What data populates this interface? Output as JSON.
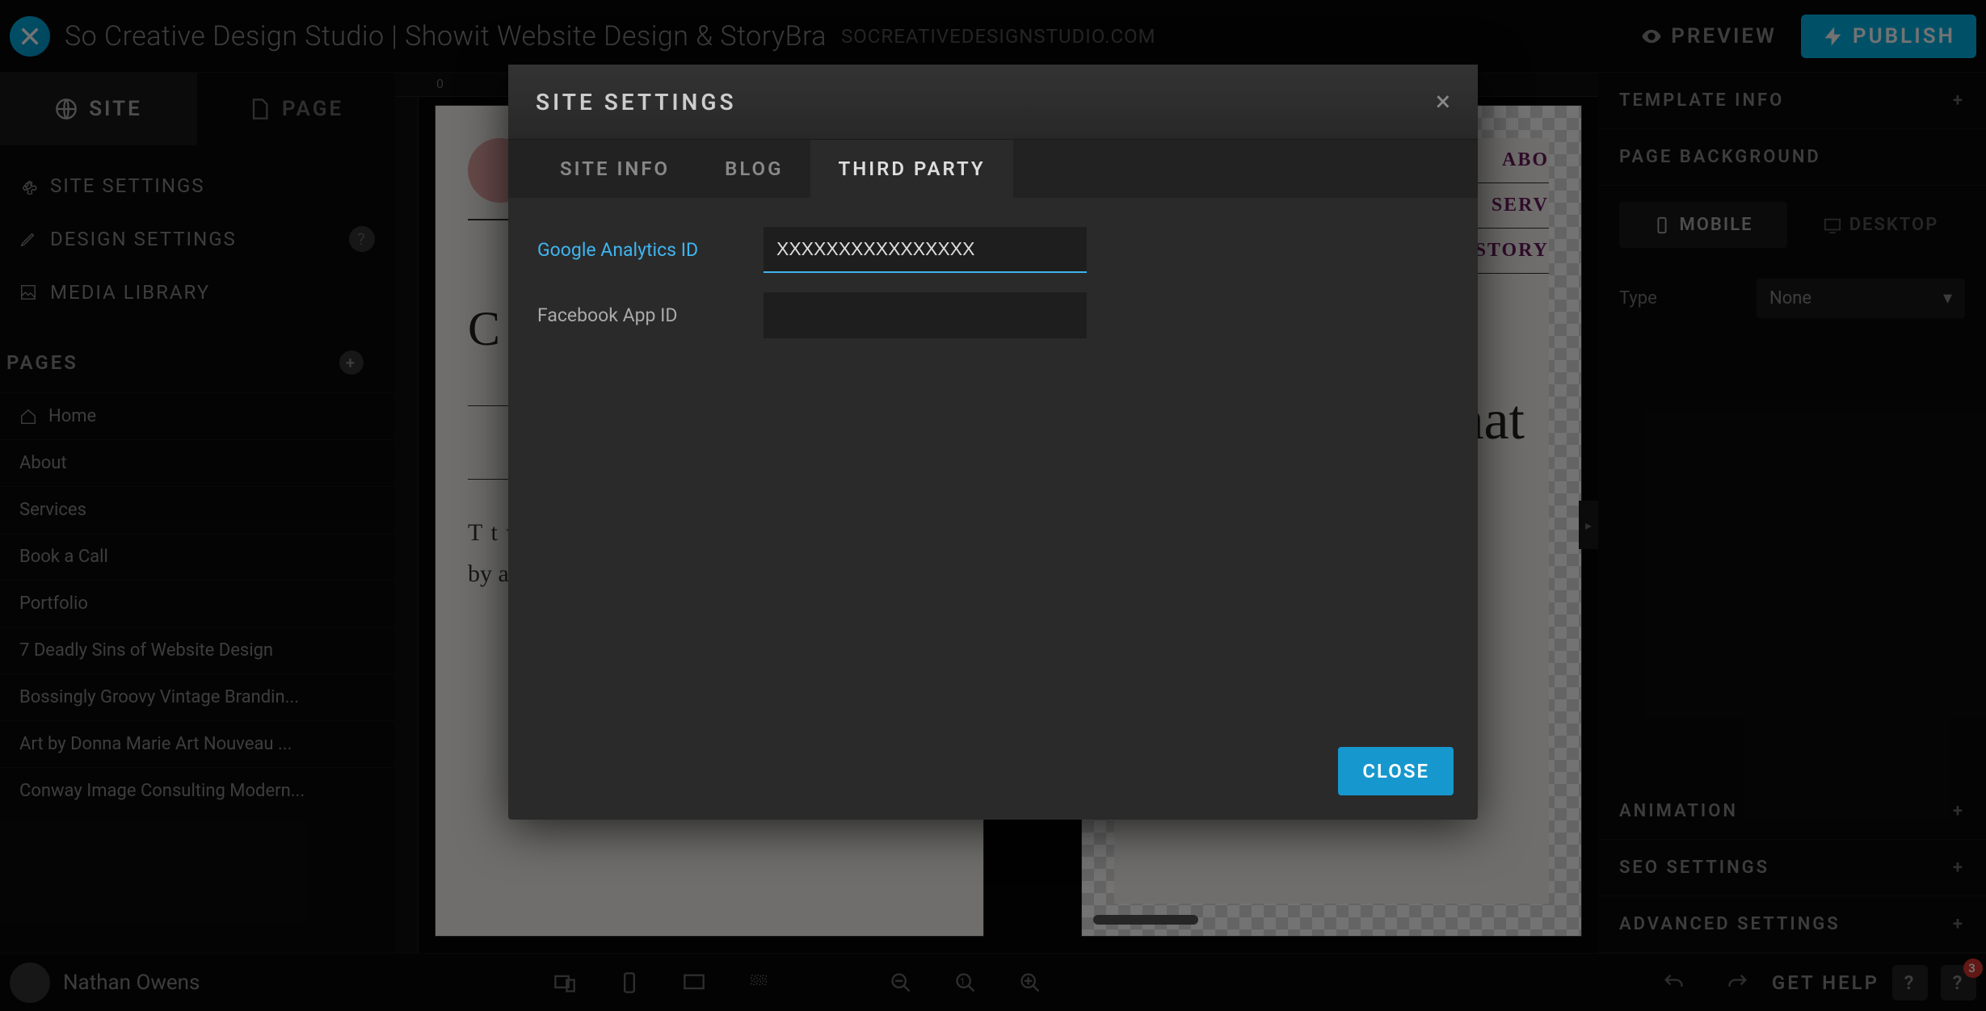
{
  "topbar": {
    "site_title": "So Creative Design Studio | Showit Website Design & StoryBra",
    "site_url": "SOCREATIVEDESIGNSTUDIO.COM",
    "preview_label": "PREVIEW",
    "publish_label": "PUBLISH"
  },
  "left_tabs": {
    "site": "SITE",
    "page": "PAGE"
  },
  "sidebar": {
    "site_settings": "SITE SETTINGS",
    "design_settings": "DESIGN SETTINGS",
    "media_library": "MEDIA LIBRARY",
    "pages_header": "PAGES",
    "pages": [
      "Home",
      "About",
      "Services",
      "Book a Call",
      "Portfolio",
      "7 Deadly Sins of Website Design",
      "Bossingly Groovy Vintage Brandin...",
      "Art by Donna Marie Art Nouveau ...",
      "Conway Image Consulting Modern..."
    ]
  },
  "canvas": {
    "ruler_zero": "0",
    "cat_heading": "C",
    "body_text": "T\nt\nwill look like. This text will all get replaced by actual blog content. It",
    "nav_items": [
      "ABO",
      "SERV",
      "STORY"
    ],
    "hat_text": "hat"
  },
  "right_panel": {
    "template_info": "TEMPLATE INFO",
    "page_background": "PAGE BACKGROUND",
    "mobile_tab": "MOBILE",
    "desktop_tab": "DESKTOP",
    "type_label": "Type",
    "type_value": "None",
    "animation": "ANIMATION",
    "seo_settings": "SEO SETTINGS",
    "advanced_settings": "ADVANCED SETTINGS"
  },
  "bottombar": {
    "user_name": "Nathan Owens",
    "get_help": "GET HELP",
    "badge_count": "3"
  },
  "modal": {
    "title": "SITE SETTINGS",
    "tabs": {
      "site_info": "SITE INFO",
      "blog": "BLOG",
      "third_party": "THIRD PARTY"
    },
    "fields": {
      "ga_label": "Google Analytics ID",
      "ga_value": "XXXXXXXXXXXXXXXX",
      "fb_label": "Facebook App ID",
      "fb_value": ""
    },
    "close_button": "CLOSE"
  }
}
